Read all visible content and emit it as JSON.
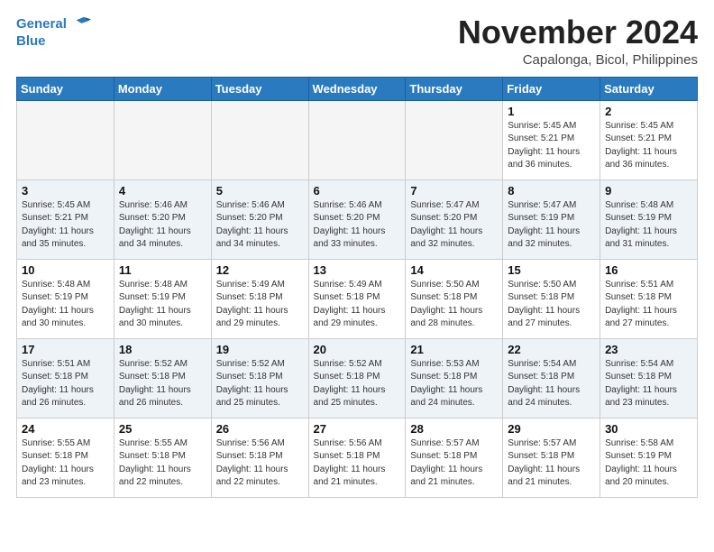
{
  "logo": {
    "line1": "General",
    "line2": "Blue"
  },
  "title": "November 2024",
  "location": "Capalonga, Bicol, Philippines",
  "weekdays": [
    "Sunday",
    "Monday",
    "Tuesday",
    "Wednesday",
    "Thursday",
    "Friday",
    "Saturday"
  ],
  "weeks": [
    [
      {
        "day": "",
        "info": ""
      },
      {
        "day": "",
        "info": ""
      },
      {
        "day": "",
        "info": ""
      },
      {
        "day": "",
        "info": ""
      },
      {
        "day": "",
        "info": ""
      },
      {
        "day": "1",
        "info": "Sunrise: 5:45 AM\nSunset: 5:21 PM\nDaylight: 11 hours\nand 36 minutes."
      },
      {
        "day": "2",
        "info": "Sunrise: 5:45 AM\nSunset: 5:21 PM\nDaylight: 11 hours\nand 36 minutes."
      }
    ],
    [
      {
        "day": "3",
        "info": "Sunrise: 5:45 AM\nSunset: 5:21 PM\nDaylight: 11 hours\nand 35 minutes."
      },
      {
        "day": "4",
        "info": "Sunrise: 5:46 AM\nSunset: 5:20 PM\nDaylight: 11 hours\nand 34 minutes."
      },
      {
        "day": "5",
        "info": "Sunrise: 5:46 AM\nSunset: 5:20 PM\nDaylight: 11 hours\nand 34 minutes."
      },
      {
        "day": "6",
        "info": "Sunrise: 5:46 AM\nSunset: 5:20 PM\nDaylight: 11 hours\nand 33 minutes."
      },
      {
        "day": "7",
        "info": "Sunrise: 5:47 AM\nSunset: 5:20 PM\nDaylight: 11 hours\nand 32 minutes."
      },
      {
        "day": "8",
        "info": "Sunrise: 5:47 AM\nSunset: 5:19 PM\nDaylight: 11 hours\nand 32 minutes."
      },
      {
        "day": "9",
        "info": "Sunrise: 5:48 AM\nSunset: 5:19 PM\nDaylight: 11 hours\nand 31 minutes."
      }
    ],
    [
      {
        "day": "10",
        "info": "Sunrise: 5:48 AM\nSunset: 5:19 PM\nDaylight: 11 hours\nand 30 minutes."
      },
      {
        "day": "11",
        "info": "Sunrise: 5:48 AM\nSunset: 5:19 PM\nDaylight: 11 hours\nand 30 minutes."
      },
      {
        "day": "12",
        "info": "Sunrise: 5:49 AM\nSunset: 5:18 PM\nDaylight: 11 hours\nand 29 minutes."
      },
      {
        "day": "13",
        "info": "Sunrise: 5:49 AM\nSunset: 5:18 PM\nDaylight: 11 hours\nand 29 minutes."
      },
      {
        "day": "14",
        "info": "Sunrise: 5:50 AM\nSunset: 5:18 PM\nDaylight: 11 hours\nand 28 minutes."
      },
      {
        "day": "15",
        "info": "Sunrise: 5:50 AM\nSunset: 5:18 PM\nDaylight: 11 hours\nand 27 minutes."
      },
      {
        "day": "16",
        "info": "Sunrise: 5:51 AM\nSunset: 5:18 PM\nDaylight: 11 hours\nand 27 minutes."
      }
    ],
    [
      {
        "day": "17",
        "info": "Sunrise: 5:51 AM\nSunset: 5:18 PM\nDaylight: 11 hours\nand 26 minutes."
      },
      {
        "day": "18",
        "info": "Sunrise: 5:52 AM\nSunset: 5:18 PM\nDaylight: 11 hours\nand 26 minutes."
      },
      {
        "day": "19",
        "info": "Sunrise: 5:52 AM\nSunset: 5:18 PM\nDaylight: 11 hours\nand 25 minutes."
      },
      {
        "day": "20",
        "info": "Sunrise: 5:52 AM\nSunset: 5:18 PM\nDaylight: 11 hours\nand 25 minutes."
      },
      {
        "day": "21",
        "info": "Sunrise: 5:53 AM\nSunset: 5:18 PM\nDaylight: 11 hours\nand 24 minutes."
      },
      {
        "day": "22",
        "info": "Sunrise: 5:54 AM\nSunset: 5:18 PM\nDaylight: 11 hours\nand 24 minutes."
      },
      {
        "day": "23",
        "info": "Sunrise: 5:54 AM\nSunset: 5:18 PM\nDaylight: 11 hours\nand 23 minutes."
      }
    ],
    [
      {
        "day": "24",
        "info": "Sunrise: 5:55 AM\nSunset: 5:18 PM\nDaylight: 11 hours\nand 23 minutes."
      },
      {
        "day": "25",
        "info": "Sunrise: 5:55 AM\nSunset: 5:18 PM\nDaylight: 11 hours\nand 22 minutes."
      },
      {
        "day": "26",
        "info": "Sunrise: 5:56 AM\nSunset: 5:18 PM\nDaylight: 11 hours\nand 22 minutes."
      },
      {
        "day": "27",
        "info": "Sunrise: 5:56 AM\nSunset: 5:18 PM\nDaylight: 11 hours\nand 21 minutes."
      },
      {
        "day": "28",
        "info": "Sunrise: 5:57 AM\nSunset: 5:18 PM\nDaylight: 11 hours\nand 21 minutes."
      },
      {
        "day": "29",
        "info": "Sunrise: 5:57 AM\nSunset: 5:18 PM\nDaylight: 11 hours\nand 21 minutes."
      },
      {
        "day": "30",
        "info": "Sunrise: 5:58 AM\nSunset: 5:19 PM\nDaylight: 11 hours\nand 20 minutes."
      }
    ]
  ]
}
